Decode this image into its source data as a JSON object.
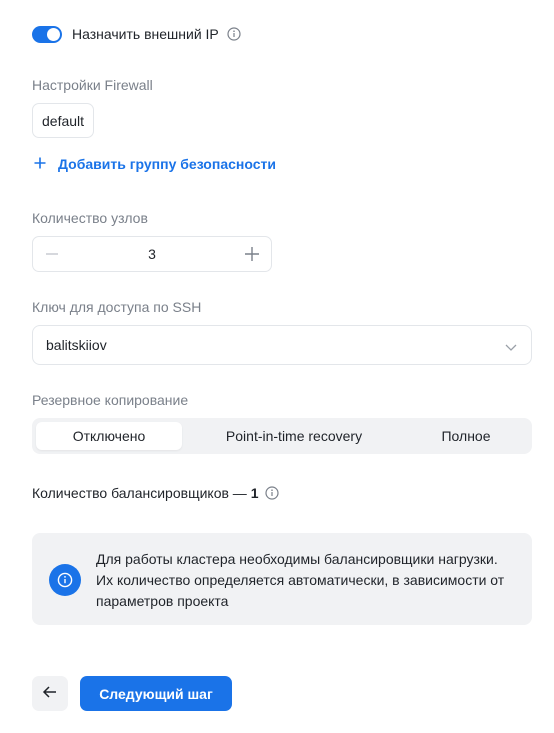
{
  "external_ip": {
    "label": "Назначить внешний IP",
    "enabled": true
  },
  "firewall": {
    "label": "Настройки Firewall",
    "selected_group": "default",
    "add_group_label": "Добавить группу безопасности"
  },
  "nodes": {
    "label": "Количество узлов",
    "value": "3"
  },
  "ssh": {
    "label": "Ключ для доступа по SSH",
    "value": "balitskiiov"
  },
  "backup": {
    "label": "Резервное копирование",
    "options": [
      "Отключено",
      "Point-in-time recovery",
      "Полное"
    ],
    "selected": "Отключено"
  },
  "balancers": {
    "label": "Количество балансировщиков — ",
    "count": "1"
  },
  "notice": {
    "text": "Для работы кластера необходимы балансировщики нагрузки. Их количество определяется автоматически, в зависимости от параметров проекта"
  },
  "footer": {
    "next_label": "Следующий шаг"
  },
  "colors": {
    "accent": "#1a73e8",
    "muted_text": "#7a808a",
    "surface": "#f1f2f4",
    "border": "#e3e6ea"
  }
}
